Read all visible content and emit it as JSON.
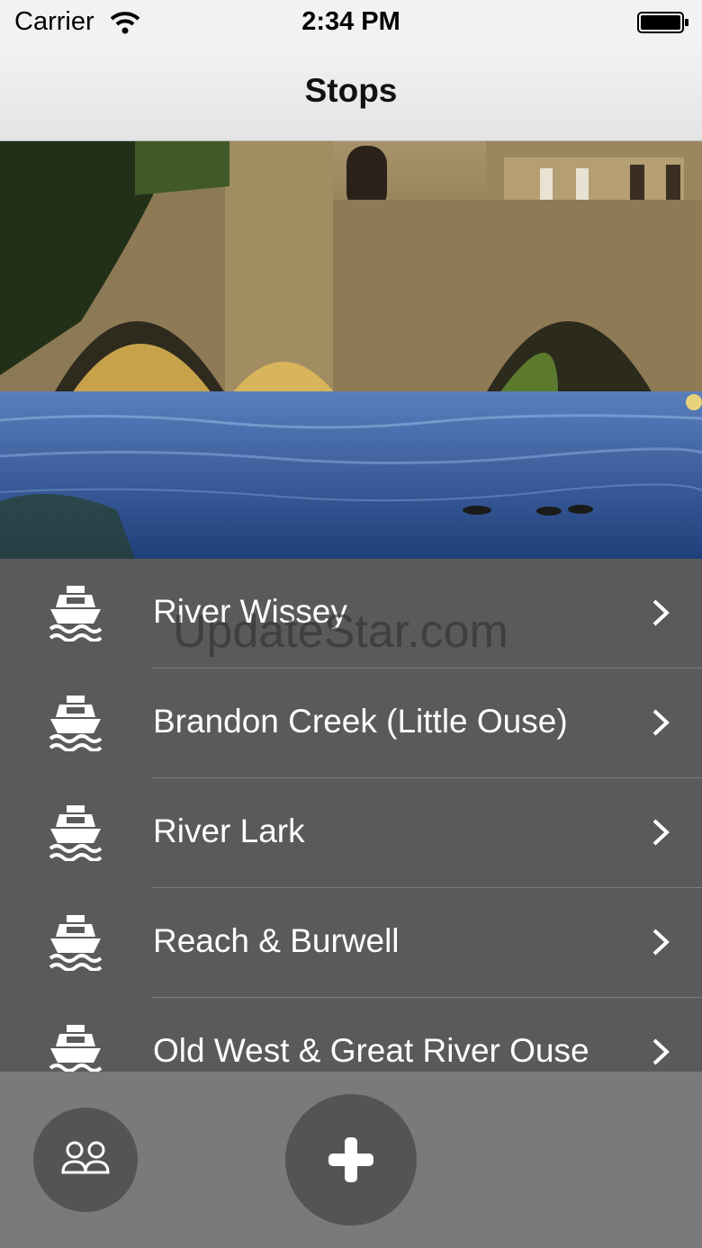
{
  "status_bar": {
    "carrier": "Carrier",
    "time": "2:34 PM"
  },
  "nav": {
    "title": "Stops"
  },
  "stops": [
    {
      "label": "River Wissey",
      "icon": "boat-icon"
    },
    {
      "label": "Brandon Creek (Little Ouse)",
      "icon": "boat-icon"
    },
    {
      "label": "River Lark",
      "icon": "boat-icon"
    },
    {
      "label": "Reach & Burwell",
      "icon": "boat-icon"
    },
    {
      "label": "Old West & Great River Ouse",
      "icon": "boat-icon"
    }
  ],
  "watermark": "UpdateStar.com",
  "toolbar": {
    "left_icon": "people-icon",
    "center_icon": "plus-icon"
  },
  "colors": {
    "list_bg": "#5a5a5a",
    "toolbar_bg": "#7a7a7a",
    "button_bg": "#545454"
  }
}
